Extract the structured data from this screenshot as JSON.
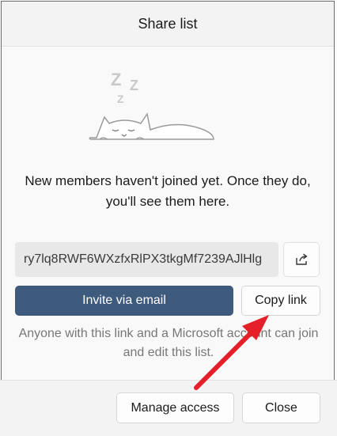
{
  "dialog": {
    "title": "Share list",
    "empty_message": "New members haven't joined yet. Once they do, you'll see them here.",
    "illustration_icon": "sleeping-cat-illustration",
    "share_link": "ry7lq8RWF6WXzfxRlPX3tkgMf7239AJlHlg",
    "share_icon": "share-icon",
    "invite_label": "Invite via email",
    "copy_label": "Copy link",
    "note": "Anyone with this link and a Microsoft account can join and edit this list.",
    "manage_label": "Manage access",
    "close_label": "Close"
  },
  "colors": {
    "primary": "#3e5a7c",
    "annotation_arrow": "#e5202a"
  }
}
